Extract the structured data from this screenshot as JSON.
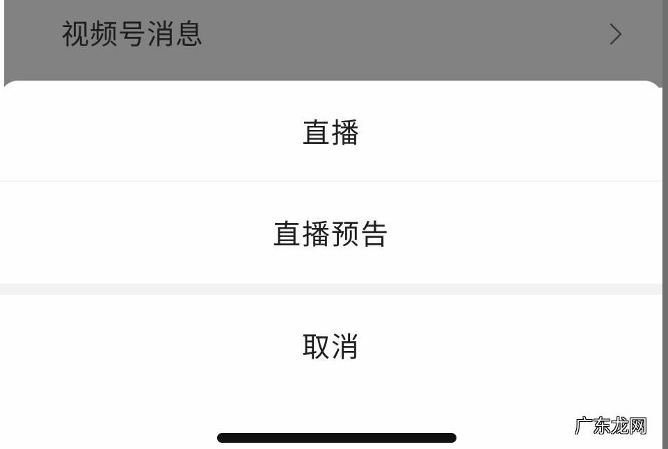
{
  "background_row": {
    "label": "视频号消息",
    "icon": "chevron-right-icon"
  },
  "action_sheet": {
    "options": [
      {
        "label": "直播"
      },
      {
        "label": "直播预告"
      }
    ],
    "cancel_label": "取消"
  },
  "watermark": "广东龙网",
  "colors": {
    "dim_overlay": "#828282",
    "sheet_background": "#fdfdfd",
    "text": "#1f1f1f",
    "separator_gap": "#f2f2f2",
    "home_indicator": "#101010"
  }
}
